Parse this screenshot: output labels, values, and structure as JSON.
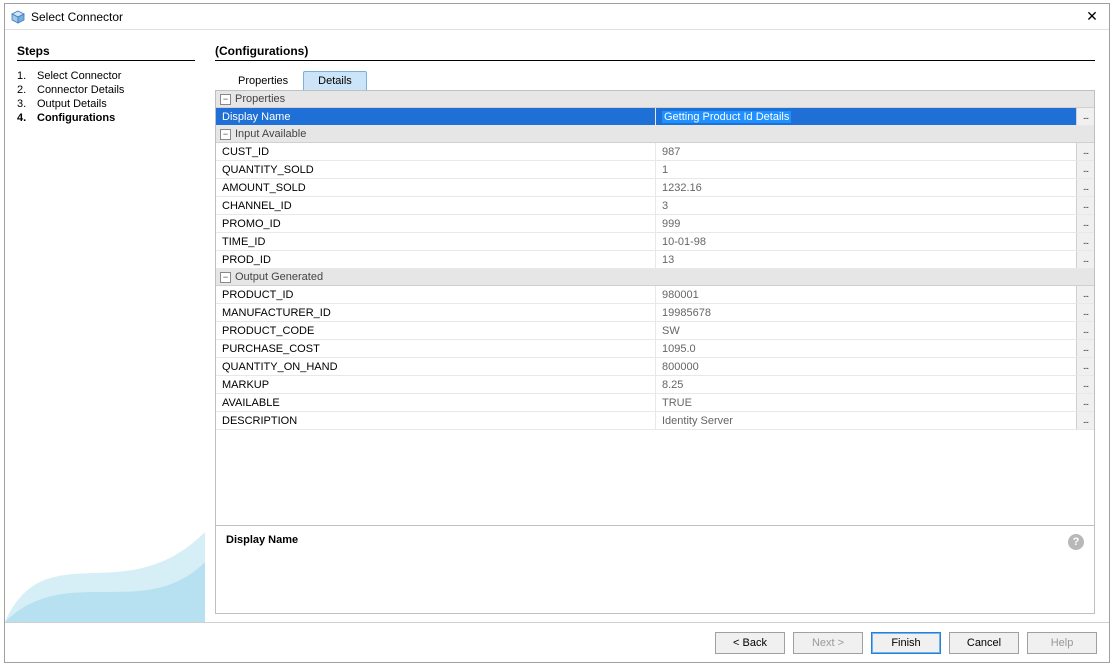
{
  "window": {
    "title": "Select Connector"
  },
  "sidebar": {
    "heading": "Steps",
    "steps": [
      {
        "num": "1.",
        "label": "Select Connector"
      },
      {
        "num": "2.",
        "label": "Connector Details"
      },
      {
        "num": "3.",
        "label": "Output Details"
      },
      {
        "num": "4.",
        "label": "Configurations"
      }
    ],
    "currentIndex": 3
  },
  "main": {
    "heading": "(Configurations)",
    "tabs": [
      {
        "label": "Properties"
      },
      {
        "label": "Details"
      }
    ],
    "activeTabIndex": 1,
    "sections": [
      {
        "title": "Properties",
        "rows": [
          {
            "label": "Display Name",
            "value": "Getting Product Id Details",
            "selected": true,
            "editing": true
          }
        ]
      },
      {
        "title": "Input Available",
        "rows": [
          {
            "label": "CUST_ID",
            "value": "987"
          },
          {
            "label": "QUANTITY_SOLD",
            "value": "1"
          },
          {
            "label": "AMOUNT_SOLD",
            "value": "1232.16"
          },
          {
            "label": "CHANNEL_ID",
            "value": "3"
          },
          {
            "label": "PROMO_ID",
            "value": "999"
          },
          {
            "label": "TIME_ID",
            "value": "10-01-98"
          },
          {
            "label": "PROD_ID",
            "value": "13"
          }
        ]
      },
      {
        "title": "Output Generated",
        "rows": [
          {
            "label": "PRODUCT_ID",
            "value": "980001"
          },
          {
            "label": "MANUFACTURER_ID",
            "value": "19985678"
          },
          {
            "label": "PRODUCT_CODE",
            "value": "SW"
          },
          {
            "label": "PURCHASE_COST",
            "value": "1095.0"
          },
          {
            "label": "QUANTITY_ON_HAND",
            "value": "800000"
          },
          {
            "label": "MARKUP",
            "value": "8.25"
          },
          {
            "label": "AVAILABLE",
            "value": "TRUE"
          },
          {
            "label": "DESCRIPTION",
            "value": "Identity Server"
          }
        ]
      }
    ],
    "description": {
      "label": "Display Name"
    }
  },
  "buttons": {
    "back": "< Back",
    "next": "Next >",
    "finish": "Finish",
    "cancel": "Cancel",
    "help": "Help"
  }
}
